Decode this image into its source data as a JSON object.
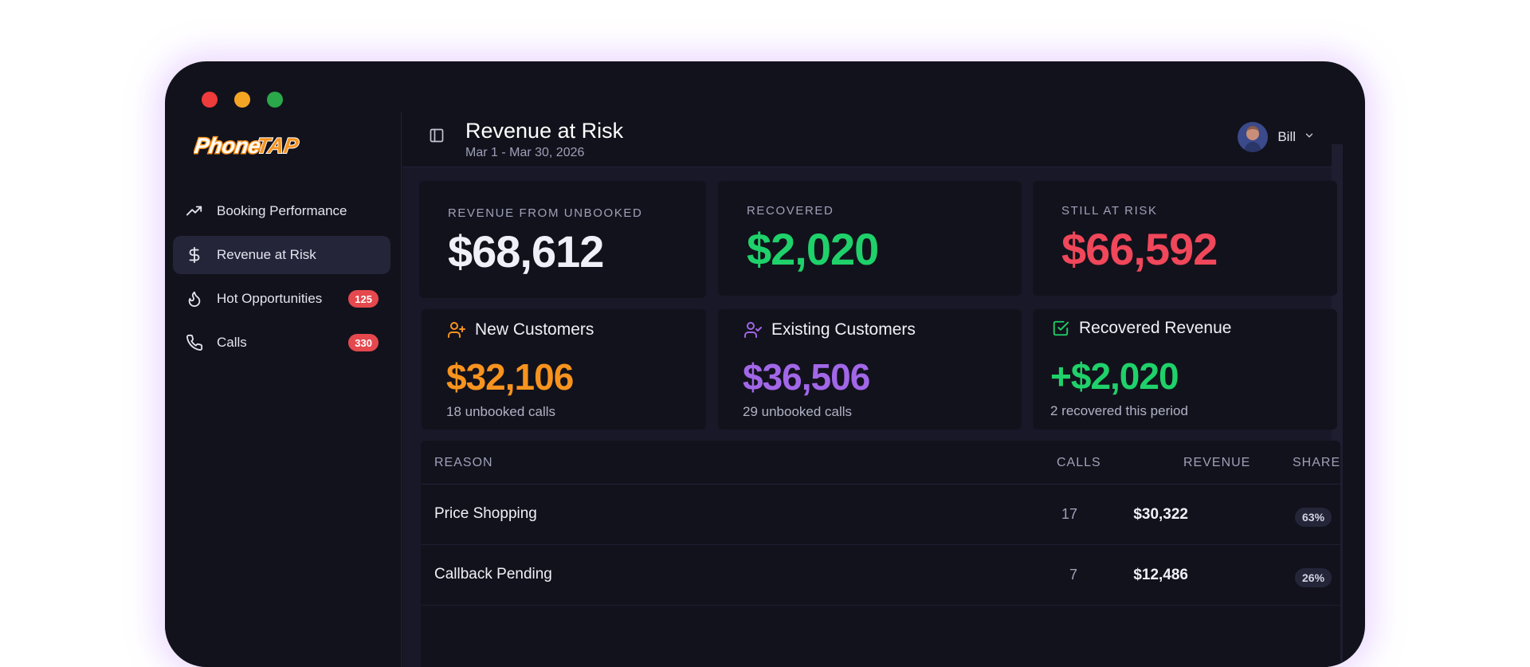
{
  "app": {
    "logo_text": "PhoneTAP"
  },
  "sidebar": {
    "items": [
      {
        "label": "Booking Performance",
        "icon": "trending-up-icon",
        "badge": null
      },
      {
        "label": "Revenue at Risk",
        "icon": "dollar-icon",
        "badge": null,
        "active": true
      },
      {
        "label": "Hot Opportunities",
        "icon": "flame-icon",
        "badge": "125"
      },
      {
        "label": "Calls",
        "icon": "phone-icon",
        "badge": "330"
      }
    ]
  },
  "header": {
    "title": "Revenue at Risk",
    "subtitle": "Mar 1 - Mar 30, 2026",
    "user_name": "Bill"
  },
  "summary": {
    "unbooked": {
      "label": "REVENUE FROM UNBOOKED",
      "value": "$68,612",
      "color": "#f0f0f8"
    },
    "recovered": {
      "label": "RECOVERED",
      "value": "$2,020",
      "color": "#1fd16a"
    },
    "at_risk": {
      "label": "STILL AT RISK",
      "value": "$66,592",
      "color": "#f0475a"
    }
  },
  "segments": {
    "new": {
      "title": "New Customers",
      "value": "$32,106",
      "sub": "18 unbooked calls",
      "color": "#f7931e",
      "icon": "user-plus-icon"
    },
    "existing": {
      "title": "Existing Customers",
      "value": "$36,506",
      "sub": "29 unbooked calls",
      "color": "#a167e8",
      "icon": "user-check-icon"
    },
    "recovered": {
      "title": "Recovered Revenue",
      "value": "+$2,020",
      "sub": "2 recovered this period",
      "color": "#1fd16a",
      "icon": "check-square-icon"
    }
  },
  "table": {
    "headers": {
      "reason": "REASON",
      "calls": "CALLS",
      "revenue": "REVENUE",
      "share": "SHARE"
    },
    "rows": [
      {
        "reason": "Price Shopping",
        "calls": "17",
        "revenue": "$30,322",
        "share": "63%"
      },
      {
        "reason": "Callback Pending",
        "calls": "7",
        "revenue": "$12,486",
        "share": "26%"
      }
    ]
  }
}
